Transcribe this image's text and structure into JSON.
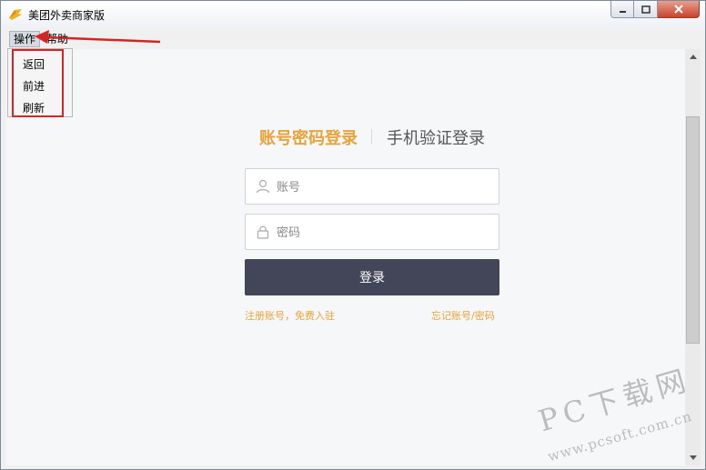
{
  "window": {
    "title": "美团外卖商家版"
  },
  "menubar": {
    "items": [
      {
        "label": "操作"
      },
      {
        "label": "帮助"
      }
    ],
    "dropdown": [
      {
        "label": "返回"
      },
      {
        "label": "前进"
      },
      {
        "label": "刷新"
      }
    ]
  },
  "login": {
    "tab_password": "账号密码登录",
    "tab_phone": "手机验证登录",
    "account_placeholder": "账号",
    "password_placeholder": "密码",
    "account_value": "",
    "password_value": "",
    "submit_label": "登录",
    "register_link": "注册账号，免费入驻",
    "forgot_link": "忘记账号/密码"
  },
  "watermark": {
    "main": "PC下载网",
    "sub": "www.pcsoft.com.cn"
  },
  "colors": {
    "accent": "#e8a33b",
    "button": "#434658",
    "annotation": "#d52424"
  },
  "icons": [
    "app-logo-icon",
    "minimize-icon",
    "maximize-icon",
    "close-icon",
    "user-icon",
    "lock-icon",
    "arrow-icon"
  ]
}
